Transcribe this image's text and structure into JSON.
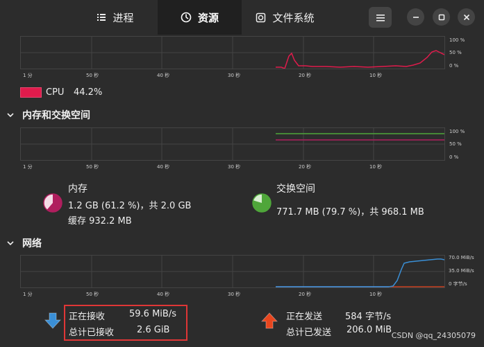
{
  "tabs": [
    {
      "label": "进程"
    },
    {
      "label": "资源"
    },
    {
      "label": "文件系统"
    }
  ],
  "icons": {
    "processes": "list-icon",
    "resources": "gauge-icon",
    "filesystems": "disk-icon",
    "menu": "hamburger-menu-icon",
    "minimize": "minimize-icon",
    "maximize": "maximize-icon",
    "close": "close-icon"
  },
  "time_axis": [
    "1 分",
    "50 秒",
    "40 秒",
    "30 秒",
    "20 秒",
    "10 秒"
  ],
  "cpu": {
    "y_labels": [
      "100 %",
      "50 %",
      "0 %"
    ],
    "label": "CPU",
    "value": "44.2%",
    "color": "#e01b4c"
  },
  "memory": {
    "title": "内存和交换空间",
    "y_labels": [
      "100 %",
      "50 %",
      "0 %"
    ],
    "mem_label": "内存",
    "mem_usage": "1.2 GB (61.2 %)，共 2.0 GB",
    "mem_cache": "缓存 932.2 MB",
    "mem_fraction": 0.612,
    "mem_color": "#b01e5e",
    "swap_label": "交换空间",
    "swap_usage": "771.7 MB (79.7 %)，共 968.1 MB",
    "swap_fraction": 0.797,
    "swap_color": "#4fa63a"
  },
  "network": {
    "title": "网络",
    "y_labels": [
      "70.0 MiB/s",
      "35.0 MiB/s",
      "0 字节/s"
    ],
    "recv_label": "正在接收",
    "recv_value": "59.6 MiB/s",
    "recv_total_label": "总计已接收",
    "recv_total_value": "2.6 GiB",
    "send_label": "正在发送",
    "send_value": "584 字节/s",
    "send_total_label": "总计已发送",
    "send_total_value": "206.0 MiB",
    "recv_color": "#3a8fd6",
    "send_color": "#e8461e"
  },
  "watermark": "CSDN @qq_24305079"
}
